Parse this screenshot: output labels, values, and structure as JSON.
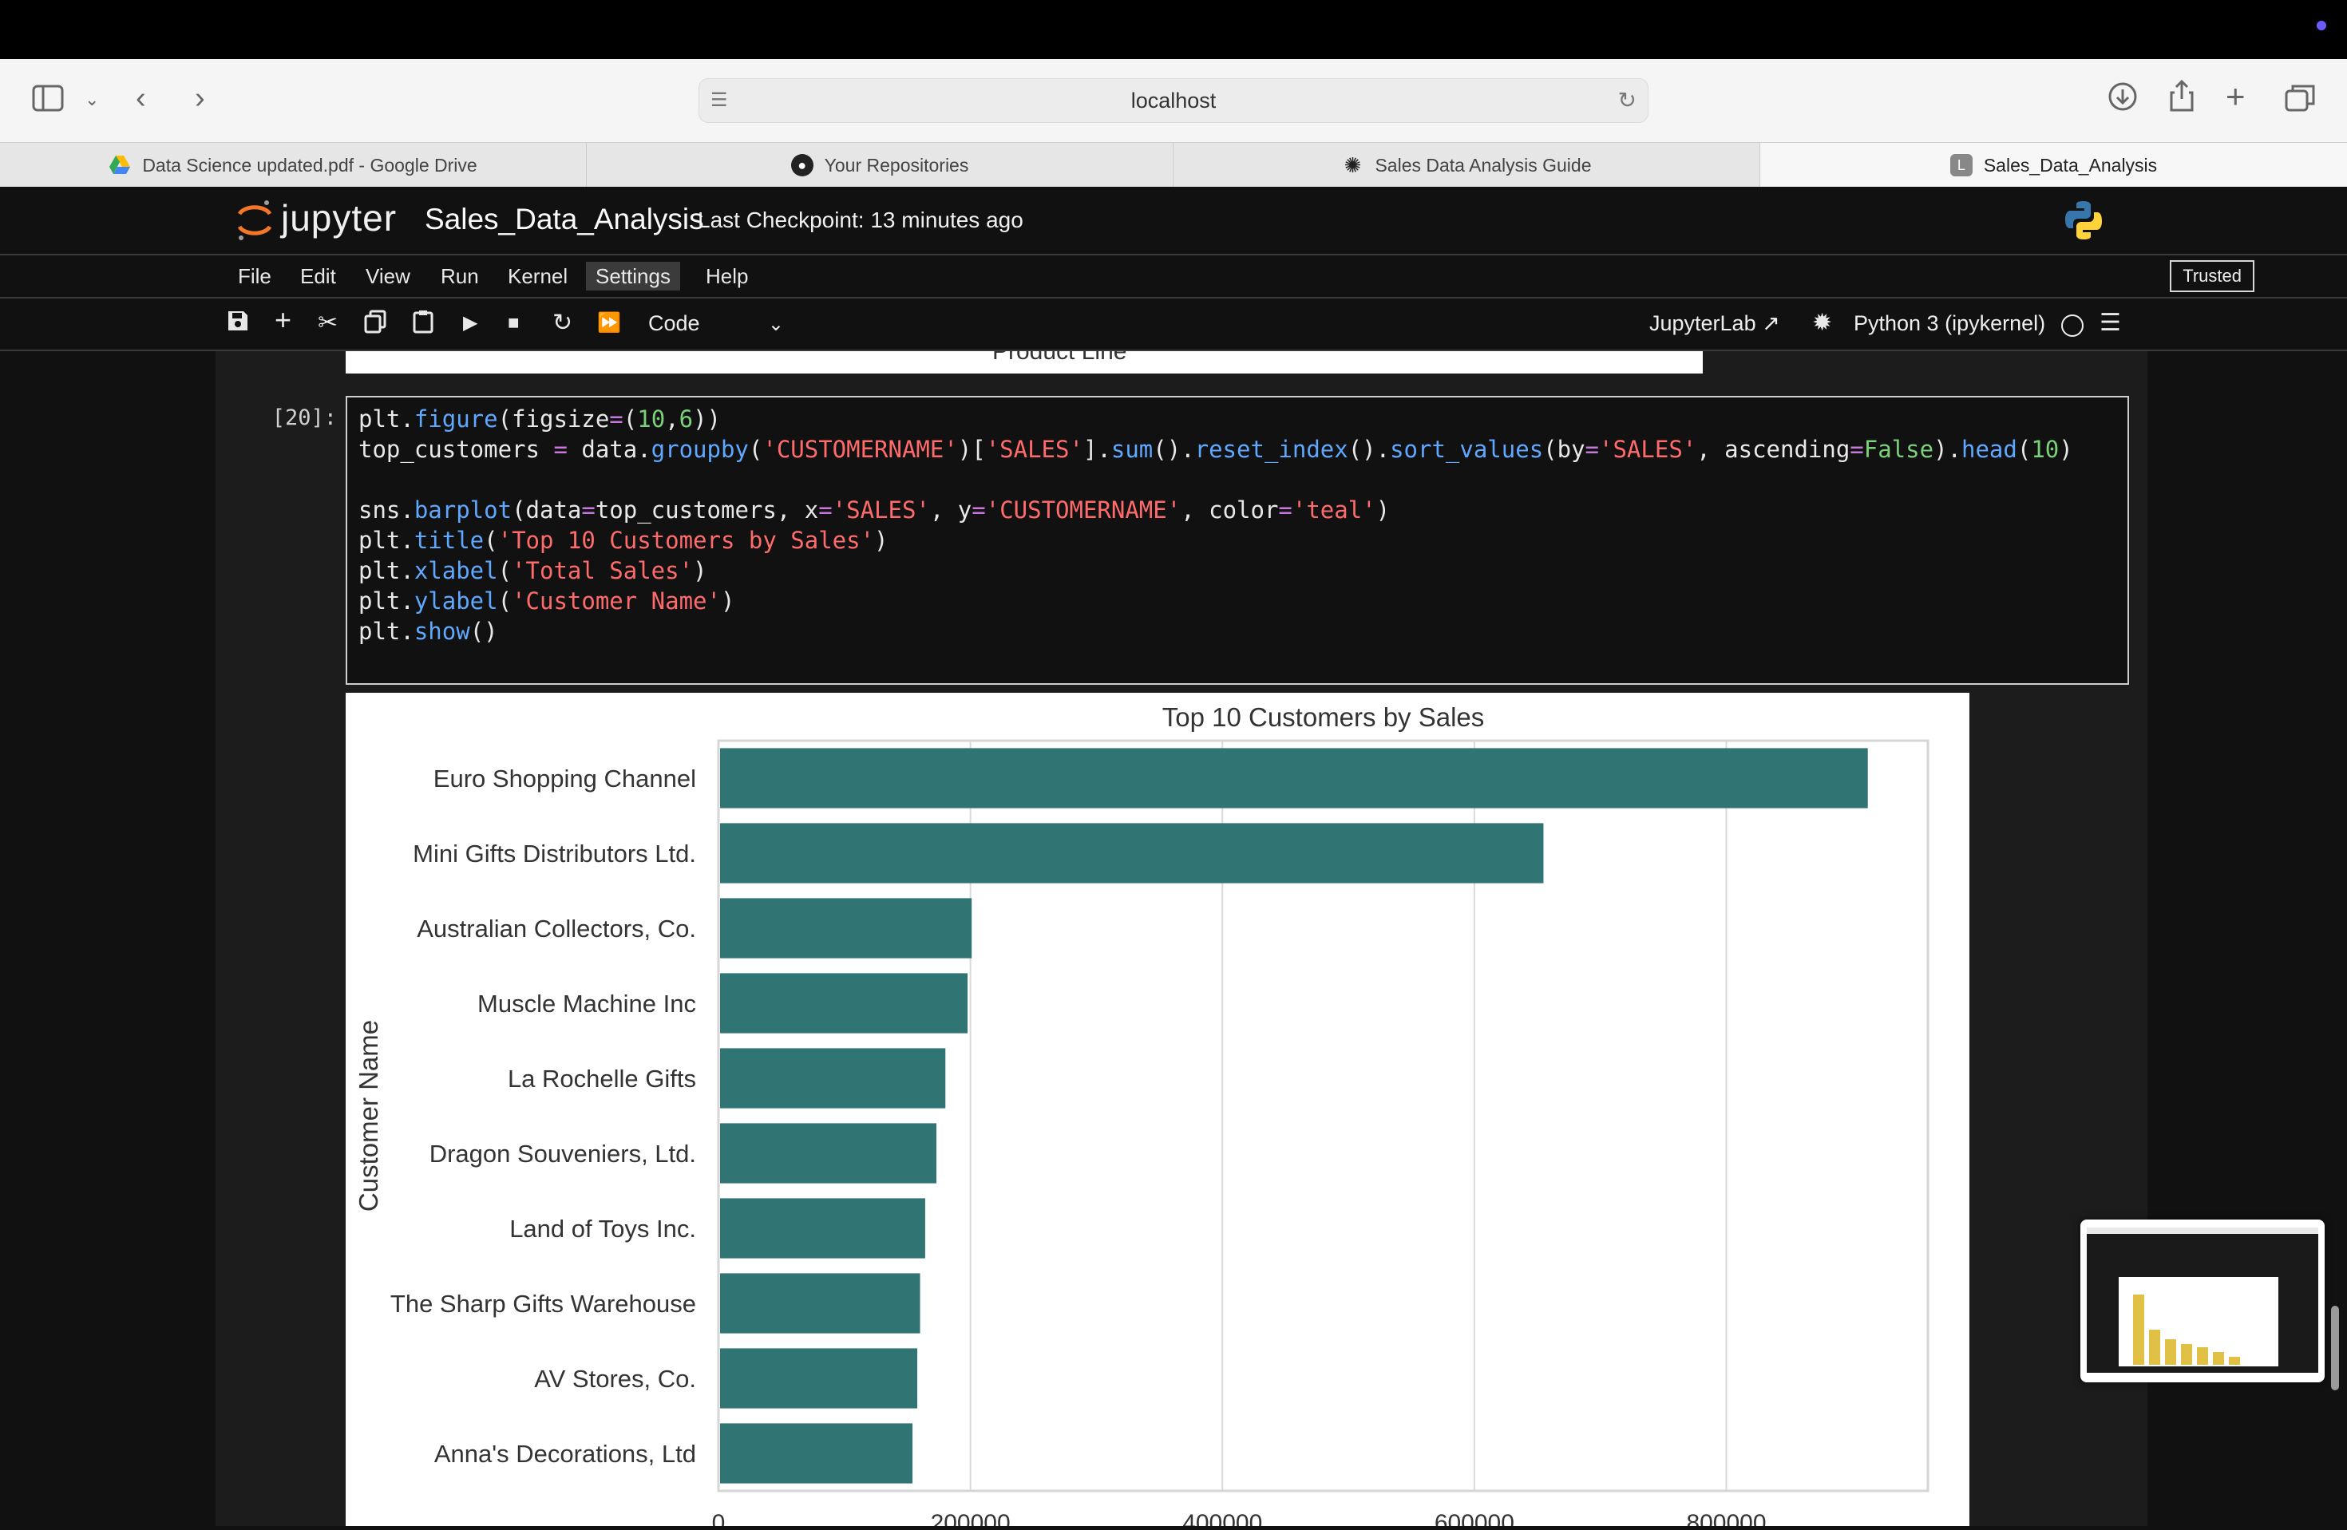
{
  "browser": {
    "url": "localhost",
    "tabs": [
      {
        "label": "Data Science updated.pdf - Google Drive",
        "icon": "google-drive-icon"
      },
      {
        "label": "Your Repositories",
        "icon": "github-icon"
      },
      {
        "label": "Sales Data Analysis Guide",
        "icon": "openai-icon"
      },
      {
        "label": "Sales_Data_Analysis",
        "icon": "L",
        "active": true
      }
    ]
  },
  "jupyter": {
    "logo": "jupyter",
    "notebook_title": "Sales_Data_Analysis",
    "checkpoint": "Last Checkpoint: 13 minutes ago",
    "menu": [
      "File",
      "Edit",
      "View",
      "Run",
      "Kernel",
      "Settings",
      "Help"
    ],
    "menu_selected": "Settings",
    "trusted": "Trusted",
    "cell_type": "Code",
    "jupyterlab_link": "JupyterLab",
    "kernel": "Python 3 (ipykernel)"
  },
  "notebook": {
    "previous_output_fragment": "Product Line",
    "cell_prompt": "[20]:",
    "code_lines": [
      "plt.figure(figsize=(10,6))",
      "top_customers = data.groupby('CUSTOMERNAME')['SALES'].sum().reset_index().sort_values(by='SALES', ascending=False).head(10)",
      "",
      "sns.barplot(data=top_customers, x='SALES', y='CUSTOMERNAME', color='teal')",
      "plt.title('Top 10 Customers by Sales')",
      "plt.xlabel('Total Sales')",
      "plt.ylabel('Customer Name')",
      "plt.show()"
    ]
  },
  "chart_data": {
    "type": "bar",
    "orientation": "horizontal",
    "title": "Top 10 Customers by Sales",
    "xlabel": "",
    "ylabel": "Customer Name",
    "categories": [
      "Euro Shopping Channel",
      "Mini Gifts Distributors Ltd.",
      "Australian Collectors, Co.",
      "Muscle Machine Inc",
      "La Rochelle Gifts",
      "Dragon Souveniers, Ltd.",
      "Land of Toys Inc.",
      "The Sharp Gifts Warehouse",
      "AV Stores, Co.",
      "Anna's Decorations, Ltd"
    ],
    "values": [
      912294,
      654858,
      200995,
      197737,
      180125,
      172990,
      164069,
      160010,
      157808,
      153996
    ],
    "xticks": [
      0,
      200000,
      400000,
      600000,
      800000
    ],
    "xlim": [
      0,
      960000
    ],
    "grid": true,
    "color": "#307473"
  },
  "colors": {
    "bar": "#307473",
    "code_function": "#5fa8ff",
    "code_string": "#ff6b6b",
    "code_number": "#7ad17a"
  }
}
